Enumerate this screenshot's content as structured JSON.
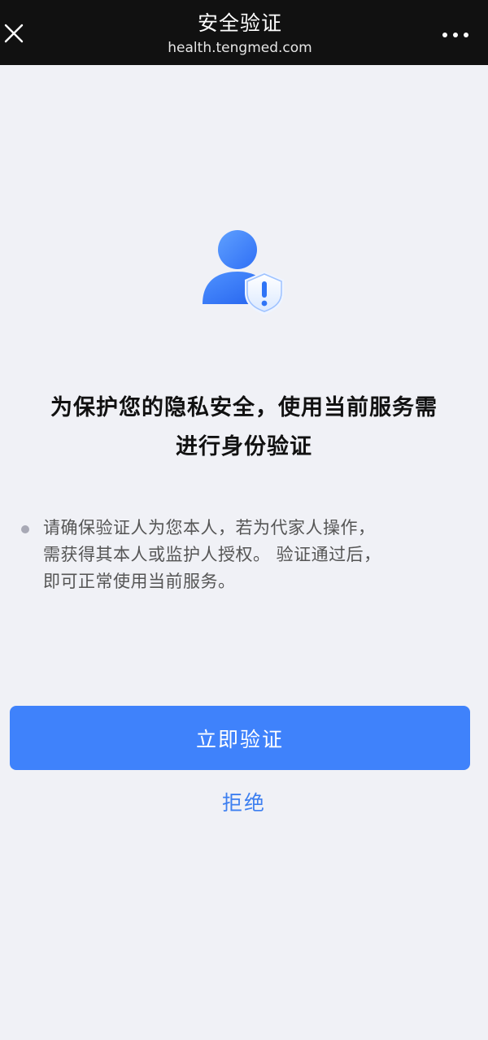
{
  "nav": {
    "title": "安全验证",
    "url": "health.tengmed.com",
    "close_icon": "close-icon",
    "more_icon": "more-icon"
  },
  "hero": {
    "icon": "user-shield-alert-icon"
  },
  "main": {
    "headline_line1": "为保护您的隐私安全，使用当前服务需",
    "headline_line2": "进行身份验证",
    "note_line1": "请确保验证人为您本人，若为代家人操作，",
    "note_line2": "需获得其本人或监护人授权。 验证通过后，",
    "note_line3": "即可正常使用当前服务。"
  },
  "actions": {
    "verify_label": "立即验证",
    "reject_label": "拒绝"
  },
  "colors": {
    "nav_bg": "#111111",
    "page_bg": "#f0f1f6",
    "accent": "#3f82fb",
    "link": "#3d7ff0"
  }
}
